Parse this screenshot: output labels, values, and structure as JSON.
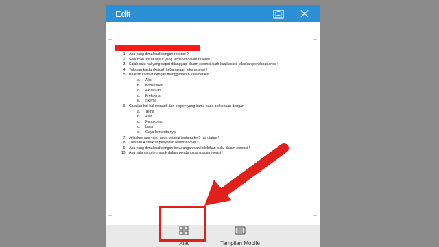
{
  "appbar": {
    "title": "Edit",
    "color": "#2b8fd6",
    "icons": [
      "reading-view-icon",
      "close-icon"
    ]
  },
  "document": {
    "items": [
      {
        "num": "1.",
        "text": "Apa yang dimaksud dengan resensi ?"
      },
      {
        "num": "2.",
        "text": "Sebutkan unsur unsur yang terdapat dalam resensi !"
      },
      {
        "num": "3.",
        "text": "Salah satu hal yang dapat ditanggapi dalam resensi ialah kualitas isi, jelaskan pendapat anda !"
      },
      {
        "num": "4.",
        "text": "Tuliskan kaidah kaidah kebahasaan teks resensi !"
      },
      {
        "num": "5.",
        "text": "Buatlah kalimat dengan menggunakan kata berikut :"
      }
    ],
    "sub5": [
      {
        "num": "a.",
        "text": "Aksi"
      },
      {
        "num": "b.",
        "text": "Konsekuen"
      },
      {
        "num": "c.",
        "text": "Akuarium"
      },
      {
        "num": "d.",
        "text": "Frekuensi"
      },
      {
        "num": "e.",
        "text": "Skema"
      }
    ],
    "item6": {
      "num": "6.",
      "text": "Catatlah hal-hal menarik dari cerpen yang kamu baca berkenaan dengan :"
    },
    "sub6": [
      {
        "num": "a.",
        "text": "Tema"
      },
      {
        "num": "b.",
        "text": "Alur"
      },
      {
        "num": "c.",
        "text": "Penokohan"
      },
      {
        "num": "d.",
        "text": "Latar"
      },
      {
        "num": "e.",
        "text": "Gaya bercerita nya"
      }
    ],
    "items_rest": [
      {
        "num": "7.",
        "text": "Jelaskan apa yang anda ketahui tentang ke 5 hal diatas !"
      },
      {
        "num": "8.",
        "text": "Tuliskan 4 struktur penyajian resensi novel !"
      },
      {
        "num": "9.",
        "text": "Apa yang dimaksud dengan kekurangan dan kelebihan buku dalam resensi !"
      },
      {
        "num": "10.",
        "text": "Apa saja yang termasuk dalam pendahuluan pada resensi !"
      }
    ]
  },
  "bottombar": {
    "alat_label": "Alat",
    "mobile_label": "Tampilan Mobile"
  },
  "annotation_color": "#e0201a"
}
